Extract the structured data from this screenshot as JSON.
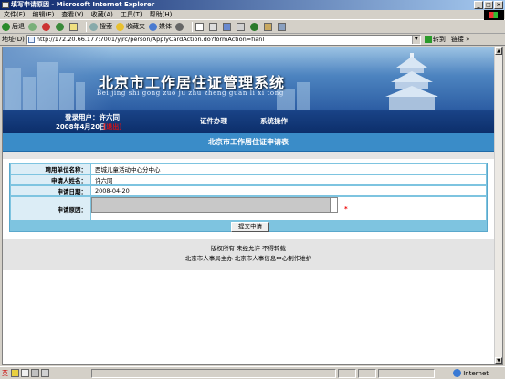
{
  "window": {
    "title": "填写申请原因 - Microsoft Internet Explorer"
  },
  "menu": [
    "文件(F)",
    "编辑(E)",
    "查看(V)",
    "收藏(A)",
    "工具(T)",
    "帮助(H)"
  ],
  "toolbar": {
    "back": "后退",
    "search": "搜索",
    "favorites": "收藏夹",
    "media": "媒体"
  },
  "address": {
    "label": "地址(D)",
    "url": "http://172.20.66.177:7001/yjrc/person/ApplyCardAction.do?formAction=fianl",
    "go": "转到",
    "links": "链接"
  },
  "banner": {
    "title": "北京市工作居住证管理系统",
    "pinyin": "Bei jing shi gong zuo ju zhu zheng guan li xi tong"
  },
  "nav": {
    "login_user": "登录用户：许六同",
    "date": "2008年4月20日",
    "logout": "[退出]",
    "items": [
      "证件办理",
      "系统操作"
    ]
  },
  "page": {
    "header": "北京市工作居住证申请表"
  },
  "form": {
    "rows": [
      {
        "label": "聘用单位名称：",
        "value": "西城儿童活动中心分中心"
      },
      {
        "label": "申请人姓名：",
        "value": "许六同"
      },
      {
        "label": "申请日期：",
        "value": "2008-04-20"
      },
      {
        "label": "申请原因：",
        "value": ""
      }
    ],
    "required_mark": "*",
    "submit": "提交申请"
  },
  "footer": {
    "line1": "版权所有 未经允许 不得转载",
    "line2": "北京市人事局主办 北京市人事信息中心制作维护"
  },
  "status": {
    "zone": "Internet",
    "ime": "英"
  }
}
